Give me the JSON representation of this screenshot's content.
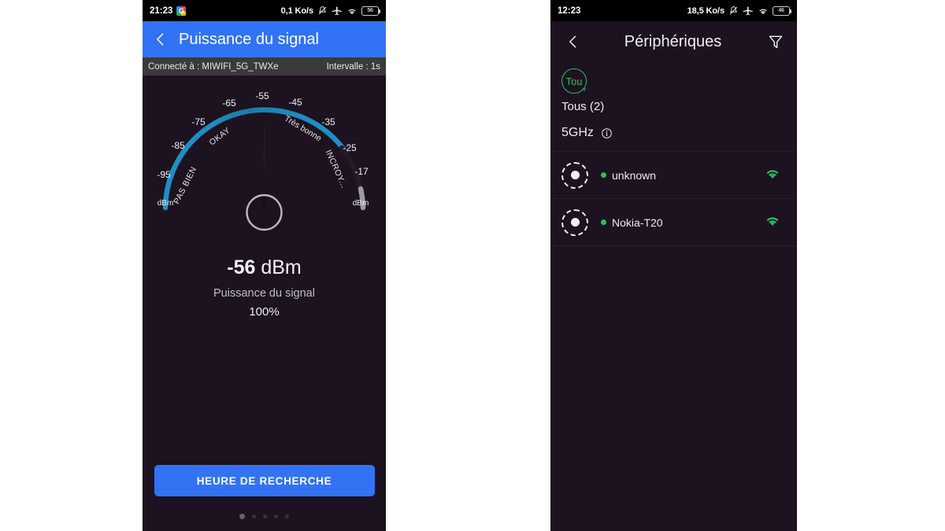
{
  "left_phone": {
    "status_bar": {
      "time": "21:23",
      "app_icon": "google-g-icon",
      "data_rate": "0,1 Ko/s",
      "icons": [
        "mute-icon",
        "airplane-mode-icon",
        "wifi-icon",
        "battery-icon"
      ],
      "battery_level": "56"
    },
    "appbar": {
      "back_icon": "back-chevron-icon",
      "title": "Puissance du signal",
      "background": "#3273f5"
    },
    "info_bar": {
      "connected_label": "Connecté à : MIWIFI_5G_TWXe",
      "interval_label": "Intervalle : 1s"
    },
    "gauge": {
      "ticks": [
        "-95",
        "-85",
        "-75",
        "-65",
        "-55",
        "-45",
        "-35",
        "-25",
        "-17"
      ],
      "unit_left": "dBm",
      "unit_right": "dBm",
      "zones": [
        "PAS BIEN",
        "OKAY",
        "Très bonne",
        "INCROY..."
      ],
      "arc_color": "#1e8ec4",
      "arc_tip_color": "#9b9aa3",
      "needle_value": -56
    },
    "readout": {
      "value": "-56",
      "unit": "dBm",
      "caption": "Puissance du signal",
      "percent": "100%"
    },
    "cta_button": {
      "label": "HEURE DE RECHERCHE",
      "color": "#3273f5"
    },
    "pager": {
      "count": 5,
      "active_index": 0
    }
  },
  "right_phone": {
    "status_bar": {
      "time": "12:23",
      "data_rate": "18,5 Ko/s",
      "icons": [
        "mute-icon",
        "airplane-mode-icon",
        "wifi-icon",
        "battery-icon"
      ],
      "battery_level": "46"
    },
    "appbar": {
      "back_icon": "back-chevron-icon",
      "title": "Périphériques",
      "filter_icon": "filter-icon"
    },
    "filter_chip": {
      "icon_text": "Tou",
      "label": "Tous (2)",
      "color": "#2bbd5e"
    },
    "section": {
      "label": "5GHz",
      "info_icon": "info-icon"
    },
    "devices": [
      {
        "name": "unknown",
        "status": "online",
        "signal_icon": "wifi-icon",
        "avatar_icon": "device-avatar-icon"
      },
      {
        "name": "Nokia-T20",
        "status": "online",
        "signal_icon": "wifi-icon",
        "avatar_icon": "device-avatar-icon"
      }
    ]
  },
  "chart_data": {
    "type": "gauge",
    "title": "Puissance du signal",
    "unit": "dBm",
    "value": -56,
    "percent": 100,
    "min": -95,
    "max": -17,
    "ticks": [
      -95,
      -85,
      -75,
      -65,
      -55,
      -45,
      -35,
      -25,
      -17
    ],
    "zones": [
      {
        "label": "PAS BIEN",
        "from": -95,
        "to": -75
      },
      {
        "label": "OKAY",
        "from": -75,
        "to": -55
      },
      {
        "label": "Très bonne",
        "from": -55,
        "to": -35
      },
      {
        "label": "INCROY...",
        "from": -35,
        "to": -17
      }
    ],
    "arc_color": "#1e8ec4",
    "arc_inactive_color": "#9b9aa3"
  }
}
